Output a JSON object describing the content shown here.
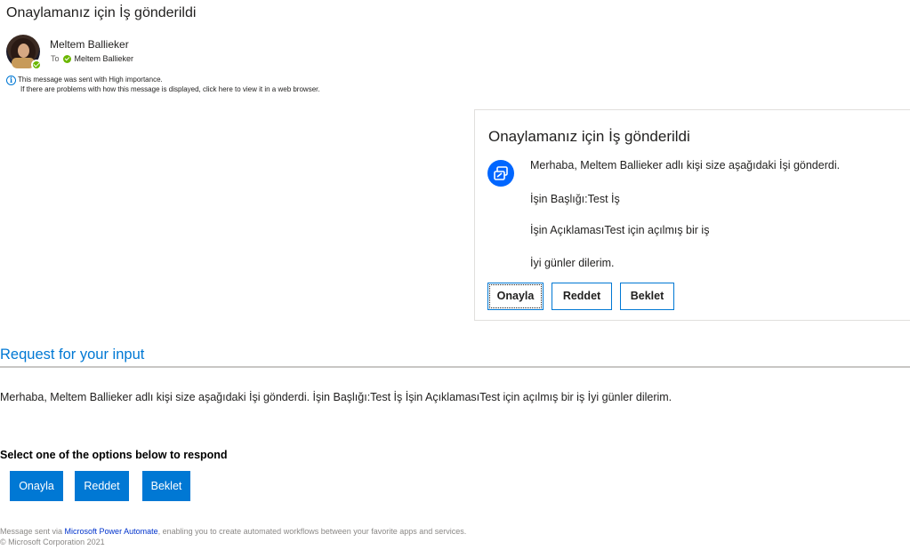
{
  "email": {
    "subject": "Onaylamanız için İş gönderildi",
    "sender_name": "Meltem Ballieker",
    "to_prefix": "To",
    "to_name": "Meltem Ballieker",
    "info_line1": "This message was sent with High importance.",
    "info_line2": "If there are problems with how this message is displayed, click here to view it in a web browser."
  },
  "card": {
    "title": "Onaylamanız için İş gönderildi",
    "lines": [
      "Merhaba, Meltem Ballieker adlı kişi size aşağıdaki İşi gönderdi.",
      "İşin Başlığı:Test İş",
      "İşin AçıklamasıTest için açılmış bir iş",
      "İyi günler dilerim."
    ],
    "buttons": [
      "Onayla",
      "Reddet",
      "Beklet"
    ]
  },
  "request": {
    "title": "Request for your input",
    "body": "Merhaba, Meltem Ballieker adlı kişi size aşağıdaki İşi gönderdi. İşin Başlığı:Test İş İşin AçıklamasıTest için açılmış bir iş İyi günler dilerim.",
    "select_label": "Select one of the options below to respond",
    "buttons": [
      "Onayla",
      "Reddet",
      "Beklet"
    ]
  },
  "footer": {
    "prefix": "Message sent via ",
    "link": "Microsoft Power Automate",
    "suffix": ", enabling you to create automated workflows between your favorite apps and services.",
    "copyright": "© Microsoft Corporation 2021"
  },
  "colors": {
    "accent": "#0078d4",
    "presence": "#6bb700",
    "card_icon": "#0066ff"
  }
}
